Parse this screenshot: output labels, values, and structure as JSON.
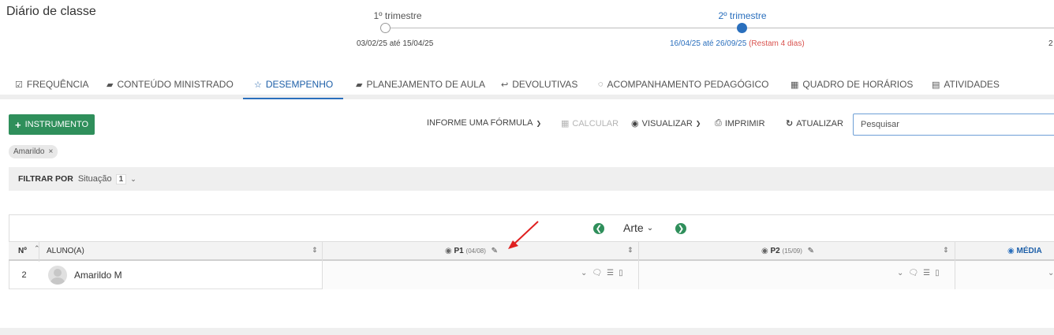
{
  "page": {
    "title": "Diário de classe"
  },
  "timeline": [
    {
      "label": "1º trimestre",
      "range": "03/02/25 até 15/04/25",
      "remaining": ""
    },
    {
      "label": "2º trimestre",
      "range": "16/04/25 até 26/09/25",
      "remaining": "(Restam 4 dias)"
    },
    {
      "label": "",
      "range": "2",
      "remaining": ""
    }
  ],
  "tabs": [
    {
      "label": "FREQUÊNCIA",
      "icon": "check-square-icon",
      "glyph": "☑"
    },
    {
      "label": "CONTEÚDO MINISTRADO",
      "icon": "book-icon",
      "glyph": "▰"
    },
    {
      "label": "DESEMPENHO",
      "icon": "star-icon",
      "glyph": "☆",
      "active": true
    },
    {
      "label": "PLANEJAMENTO DE AULA",
      "icon": "book-icon",
      "glyph": "▰"
    },
    {
      "label": "DEVOLUTIVAS",
      "icon": "reply-all-icon",
      "glyph": "↩"
    },
    {
      "label": "ACOMPANHAMENTO PEDAGÓGICO",
      "icon": "comment-icon",
      "glyph": "◌"
    },
    {
      "label": "QUADRO DE HORÁRIOS",
      "icon": "calendar-icon",
      "glyph": "▦"
    },
    {
      "label": "ATIVIDADES",
      "icon": "file-icon",
      "glyph": "▤"
    }
  ],
  "toolbar": {
    "add_instrument": "INSTRUMENTO",
    "formula": "INFORME UMA FÓRMULA",
    "calculate": "CALCULAR",
    "view": "VISUALIZAR",
    "print": "IMPRIMIR",
    "refresh": "ATUALIZAR",
    "search_placeholder": "Pesquisar"
  },
  "chip": {
    "label": "Amarildo"
  },
  "filter": {
    "label": "FILTRAR POR",
    "field": "Situação",
    "count": "1"
  },
  "table": {
    "subject": "Arte",
    "headers": {
      "number": "Nº",
      "student": "ALUNO(A)",
      "p1": "P1",
      "p1_date": "(04/08)",
      "p2": "P2",
      "p2_date": "(15/09)",
      "average": "MÉDIA"
    },
    "rows": [
      {
        "number": "2",
        "name": "Amarildo M"
      }
    ]
  },
  "colors": {
    "accent": "#1d5fa8",
    "green": "#2f8f5b",
    "alert": "#d9534f",
    "annotation_arrow": "#e02020"
  }
}
